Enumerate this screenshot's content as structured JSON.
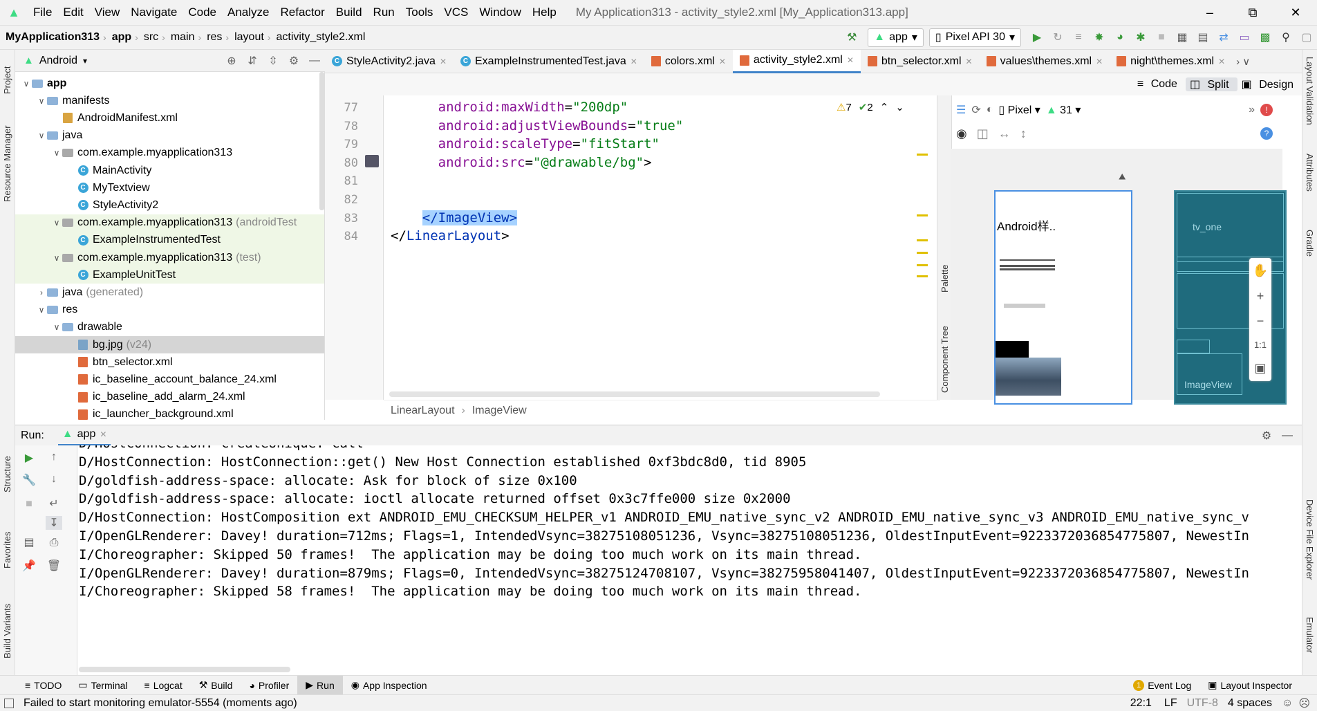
{
  "menu": {
    "items": [
      "File",
      "Edit",
      "View",
      "Navigate",
      "Code",
      "Analyze",
      "Refactor",
      "Build",
      "Run",
      "Tools",
      "VCS",
      "Window",
      "Help"
    ],
    "window_title": "My Application313 - activity_style2.xml [My_Application313.app]"
  },
  "nav": {
    "crumbs": [
      "MyApplication313",
      "app",
      "src",
      "main",
      "res",
      "layout",
      "activity_style2.xml"
    ],
    "run_config": "app",
    "device": "Pixel API 30"
  },
  "left_strip": {
    "project": "Project",
    "resource_manager": "Resource Manager",
    "structure": "Structure",
    "favorites": "Favorites",
    "build_variants": "Build Variants"
  },
  "right_strip": {
    "layout_validation": "Layout Validation",
    "attributes": "Attributes",
    "gradle": "Gradle",
    "device_file_explorer": "Device File Explorer",
    "emulator": "Emulator"
  },
  "project": {
    "view_mode": "Android",
    "tree": [
      {
        "label": "app",
        "extra": "",
        "indent": 0,
        "icon": "folder",
        "arrow": "down",
        "style": "bold"
      },
      {
        "label": "manifests",
        "extra": "",
        "indent": 1,
        "icon": "folder",
        "arrow": "down",
        "style": ""
      },
      {
        "label": "AndroidManifest.xml",
        "extra": "",
        "indent": 2,
        "icon": "manifest",
        "arrow": "",
        "style": ""
      },
      {
        "label": "java",
        "extra": "",
        "indent": 1,
        "icon": "folder",
        "arrow": "down",
        "style": ""
      },
      {
        "label": "com.example.myapplication313",
        "extra": "",
        "indent": 2,
        "icon": "package",
        "arrow": "down",
        "style": ""
      },
      {
        "label": "MainActivity",
        "extra": "",
        "indent": 3,
        "icon": "class",
        "arrow": "",
        "style": ""
      },
      {
        "label": "MyTextview",
        "extra": "",
        "indent": 3,
        "icon": "class",
        "arrow": "",
        "style": ""
      },
      {
        "label": "StyleActivity2",
        "extra": "",
        "indent": 3,
        "icon": "class",
        "arrow": "",
        "style": ""
      },
      {
        "label": "com.example.myapplication313",
        "extra": "(androidTest",
        "indent": 2,
        "icon": "package",
        "arrow": "down",
        "style": "green"
      },
      {
        "label": "ExampleInstrumentedTest",
        "extra": "",
        "indent": 3,
        "icon": "class",
        "arrow": "",
        "style": "green"
      },
      {
        "label": "com.example.myapplication313",
        "extra": "(test)",
        "indent": 2,
        "icon": "package",
        "arrow": "down",
        "style": "green"
      },
      {
        "label": "ExampleUnitTest",
        "extra": "",
        "indent": 3,
        "icon": "class",
        "arrow": "",
        "style": "green"
      },
      {
        "label": "java",
        "extra": "(generated)",
        "indent": 1,
        "icon": "folder",
        "arrow": "right",
        "style": ""
      },
      {
        "label": "res",
        "extra": "",
        "indent": 1,
        "icon": "folder",
        "arrow": "down",
        "style": ""
      },
      {
        "label": "drawable",
        "extra": "",
        "indent": 2,
        "icon": "folder",
        "arrow": "down",
        "style": ""
      },
      {
        "label": "bg.jpg",
        "extra": "(v24)",
        "indent": 3,
        "icon": "image",
        "arrow": "",
        "style": "sel"
      },
      {
        "label": "btn_selector.xml",
        "extra": "",
        "indent": 3,
        "icon": "xml",
        "arrow": "",
        "style": ""
      },
      {
        "label": "ic_baseline_account_balance_24.xml",
        "extra": "",
        "indent": 3,
        "icon": "xml",
        "arrow": "",
        "style": ""
      },
      {
        "label": "ic_baseline_add_alarm_24.xml",
        "extra": "",
        "indent": 3,
        "icon": "xml",
        "arrow": "",
        "style": ""
      },
      {
        "label": "ic_launcher_background.xml",
        "extra": "",
        "indent": 3,
        "icon": "xml",
        "arrow": "",
        "style": ""
      }
    ]
  },
  "tabs": [
    {
      "label": "StyleActivity2.java",
      "active": false,
      "icon": "class"
    },
    {
      "label": "ExampleInstrumentedTest.java",
      "active": false,
      "icon": "class"
    },
    {
      "label": "colors.xml",
      "active": false,
      "icon": "xml"
    },
    {
      "label": "activity_style2.xml",
      "active": true,
      "icon": "xml"
    },
    {
      "label": "btn_selector.xml",
      "active": false,
      "icon": "xml"
    },
    {
      "label": "values\\themes.xml",
      "active": false,
      "icon": "xml"
    },
    {
      "label": "night\\themes.xml",
      "active": false,
      "icon": "xml"
    }
  ],
  "view_modes": {
    "code": "Code",
    "split": "Split",
    "design": "Design"
  },
  "editor": {
    "lines": [
      {
        "num": "77",
        "parts": [
          [
            "at",
            "android:"
          ],
          [
            "at",
            "maxWidth"
          ],
          [
            "plain",
            "="
          ],
          [
            "st",
            "\"200dp\""
          ]
        ]
      },
      {
        "num": "78",
        "parts": [
          [
            "at",
            "android:"
          ],
          [
            "at",
            "adjustViewBounds"
          ],
          [
            "plain",
            "="
          ],
          [
            "st",
            "\"true\""
          ]
        ]
      },
      {
        "num": "79",
        "parts": [
          [
            "at",
            "android:"
          ],
          [
            "at",
            "scaleType"
          ],
          [
            "plain",
            "="
          ],
          [
            "st",
            "\"fitStart\""
          ]
        ]
      },
      {
        "num": "80",
        "parts": [
          [
            "at",
            "android:"
          ],
          [
            "at",
            "src"
          ],
          [
            "plain",
            "="
          ],
          [
            "st",
            "\"@drawable/bg\""
          ],
          [
            "plain",
            ">"
          ]
        ]
      },
      {
        "num": "81",
        "parts": []
      },
      {
        "num": "82",
        "parts": []
      },
      {
        "num": "83",
        "parts": [
          [
            "kw",
            "</ImageView>"
          ]
        ]
      },
      {
        "num": "84",
        "parts": [
          [
            "plain",
            "</"
          ],
          [
            "kw",
            "LinearLayout"
          ],
          [
            "plain",
            ">"
          ]
        ]
      }
    ],
    "warnings": "7",
    "weak_warnings": "2",
    "breadcrumbs": [
      "LinearLayout",
      "ImageView"
    ]
  },
  "design": {
    "device": "Pixel",
    "api": "31",
    "preview_text": "Android样..",
    "blueprint_label_top": "tv_one",
    "blueprint_label_image": "ImageView",
    "zoom_fit": "1:1",
    "palette": "Palette",
    "component_tree": "Component Tree"
  },
  "run": {
    "label": "Run:",
    "config": "app",
    "log": [
      "D/HostConnection: createUnique: call",
      "D/HostConnection: HostConnection::get() New Host Connection established 0xf3bdc8d0, tid 8905",
      "D/goldfish-address-space: allocate: Ask for block of size 0x100",
      "D/goldfish-address-space: allocate: ioctl allocate returned offset 0x3c7ffe000 size 0x2000",
      "D/HostConnection: HostComposition ext ANDROID_EMU_CHECKSUM_HELPER_v1 ANDROID_EMU_native_sync_v2 ANDROID_EMU_native_sync_v3 ANDROID_EMU_native_sync_v",
      "I/OpenGLRenderer: Davey! duration=712ms; Flags=1, IntendedVsync=38275108051236, Vsync=38275108051236, OldestInputEvent=9223372036854775807, NewestIn",
      "I/Choreographer: Skipped 50 frames!  The application may be doing too much work on its main thread.",
      "I/OpenGLRenderer: Davey! duration=879ms; Flags=0, IntendedVsync=38275124708107, Vsync=38275958041407, OldestInputEvent=9223372036854775807, NewestIn",
      "I/Choreographer: Skipped 58 frames!  The application may be doing too much work on its main thread."
    ]
  },
  "toolwindows": {
    "todo": "TODO",
    "terminal": "Terminal",
    "logcat": "Logcat",
    "build": "Build",
    "profiler": "Profiler",
    "run": "Run",
    "app_inspection": "App Inspection",
    "event_log_count": "1",
    "event_log": "Event Log",
    "layout_inspector": "Layout Inspector"
  },
  "status": {
    "message": "Failed to start monitoring emulator-5554 (moments ago)",
    "position": "22:1",
    "line_sep": "LF",
    "encoding": "UTF-8",
    "indent": "4 spaces"
  }
}
